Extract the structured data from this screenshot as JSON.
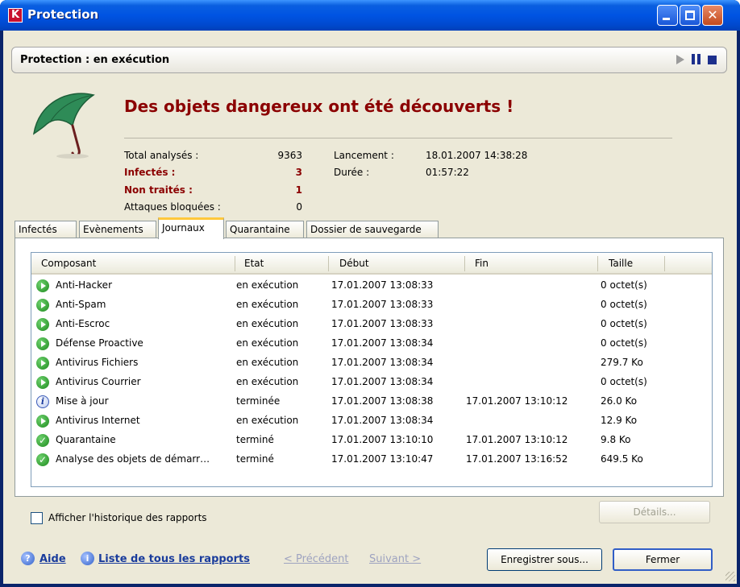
{
  "window": {
    "title": "Protection",
    "logo_letter": "K",
    "accent": "#0054e3"
  },
  "panel": {
    "title": "Protection : en exécution",
    "controls": [
      "play-icon",
      "pause-icon",
      "stop-icon"
    ]
  },
  "status": {
    "heading": "Des objets dangereux ont été découverts !",
    "icon": "umbrella-icon",
    "heading_color": "#8b0000"
  },
  "stats": {
    "total_label": "Total analysés :",
    "total_value": "9363",
    "infected_label": "Infectés :",
    "infected_value": "3",
    "untreated_label": "Non traités :",
    "untreated_value": "1",
    "blocked_label": "Attaques bloquées :",
    "blocked_value": "0",
    "launch_label": "Lancement :",
    "launch_value": "18.01.2007 14:38:28",
    "duration_label": "Durée :",
    "duration_value": "01:57:22"
  },
  "tabs": [
    "Infectés",
    "Evènements",
    "Journaux",
    "Quarantaine",
    "Dossier de sauvegarde"
  ],
  "active_tab": "Journaux",
  "table": {
    "columns": [
      "Composant",
      "Etat",
      "Début",
      "Fin",
      "Taille"
    ],
    "rows": [
      {
        "icon": "run",
        "component": "Anti-Hacker",
        "state": "en exécution",
        "start": "17.01.2007 13:08:33",
        "end": "",
        "size": "0 octet(s)"
      },
      {
        "icon": "run",
        "component": "Anti-Spam",
        "state": "en exécution",
        "start": "17.01.2007 13:08:33",
        "end": "",
        "size": "0 octet(s)"
      },
      {
        "icon": "run",
        "component": "Anti-Escroc",
        "state": "en exécution",
        "start": "17.01.2007 13:08:33",
        "end": "",
        "size": "0 octet(s)"
      },
      {
        "icon": "run",
        "component": "Défense Proactive",
        "state": "en exécution",
        "start": "17.01.2007 13:08:34",
        "end": "",
        "size": "0 octet(s)"
      },
      {
        "icon": "run",
        "component": "Antivirus Fichiers",
        "state": "en exécution",
        "start": "17.01.2007 13:08:34",
        "end": "",
        "size": "279.7 Ko"
      },
      {
        "icon": "run",
        "component": "Antivirus Courrier",
        "state": "en exécution",
        "start": "17.01.2007 13:08:34",
        "end": "",
        "size": "0 octet(s)"
      },
      {
        "icon": "info",
        "component": "Mise à jour",
        "state": "terminée",
        "start": "17.01.2007 13:08:38",
        "end": "17.01.2007 13:10:12",
        "size": "26.0 Ko"
      },
      {
        "icon": "run",
        "component": "Antivirus Internet",
        "state": "en exécution",
        "start": "17.01.2007 13:08:34",
        "end": "",
        "size": "12.9 Ko"
      },
      {
        "icon": "done",
        "component": "Quarantaine",
        "state": "terminé",
        "start": "17.01.2007 13:10:10",
        "end": "17.01.2007 13:10:12",
        "size": "9.8 Ko"
      },
      {
        "icon": "done",
        "component": "Analyse des objets de démarr…",
        "state": "terminé",
        "start": "17.01.2007 13:10:47",
        "end": "17.01.2007 13:16:52",
        "size": "649.5 Ko"
      }
    ]
  },
  "history_checkbox": {
    "label": "Afficher l'historique des rapports",
    "checked": false
  },
  "details_button": "Détails...",
  "footer": {
    "help_label": "Aide",
    "all_reports_label": "Liste de tous les rapports",
    "previous_label": "< Précédent",
    "next_label": "Suivant >",
    "save_as_label": "Enregistrer sous...",
    "close_label": "Fermer"
  }
}
